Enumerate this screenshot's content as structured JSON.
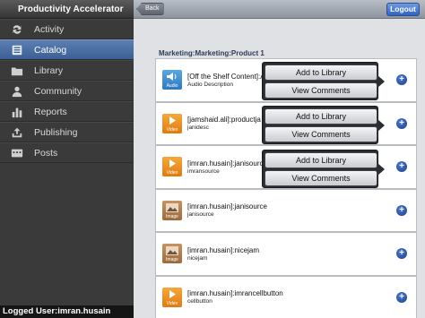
{
  "app": {
    "title": "Productivity Accelerator"
  },
  "sidebar": {
    "items": [
      {
        "label": "Activity",
        "icon": "refresh-icon",
        "active": false
      },
      {
        "label": "Catalog",
        "icon": "list-icon",
        "active": true
      },
      {
        "label": "Library",
        "icon": "folder-icon",
        "active": false
      },
      {
        "label": "Community",
        "icon": "people-icon",
        "active": false
      },
      {
        "label": "Reports",
        "icon": "bar-chart-icon",
        "active": false
      },
      {
        "label": "Publishing",
        "icon": "publish-icon",
        "active": false
      },
      {
        "label": "Posts",
        "icon": "posts-icon",
        "active": false
      }
    ],
    "footer": "Logged User:imran.husain"
  },
  "toolbar": {
    "back_label": "Back",
    "logout_label": "Logout"
  },
  "main": {
    "breadcrumb": "Marketing:Marketing:Product 1",
    "rows": [
      {
        "type": "audio",
        "type_label": "Audio",
        "title": "[Off the Shelf Content]:A",
        "subtitle": "Audio Description"
      },
      {
        "type": "video",
        "type_label": "Video",
        "title": "[jamshaid.ali]:productja",
        "subtitle": "janidesc"
      },
      {
        "type": "video",
        "type_label": "Video",
        "title": "[imran.husain]:janisource",
        "subtitle": "imransource"
      },
      {
        "type": "image",
        "type_label": "Image",
        "title": "[imran.husain]:janisource",
        "subtitle": "janisource"
      },
      {
        "type": "image",
        "type_label": "Image",
        "title": "[imran.husain]:nicejam",
        "subtitle": "nicejam"
      },
      {
        "type": "video",
        "type_label": "Video",
        "title": "[imran.husain]:imrancellbutton",
        "subtitle": "cellbutton"
      }
    ],
    "popover": {
      "add_label": "Add to Library",
      "view_label": "View Comments"
    }
  },
  "colors": {
    "accent": "#3b5f95",
    "logout": "#2f64c2",
    "sidebar": "#3a3a3a"
  }
}
